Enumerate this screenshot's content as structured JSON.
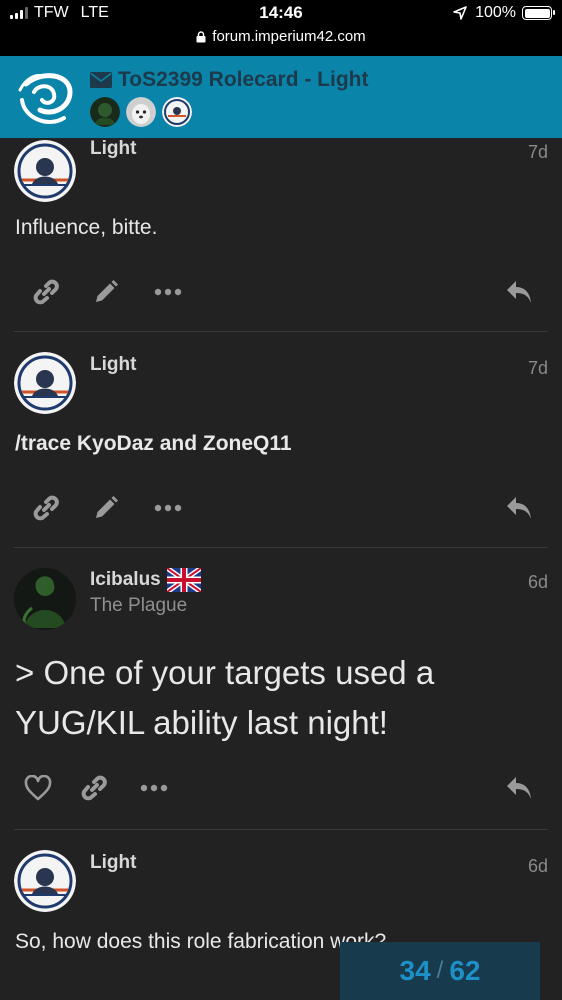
{
  "status_bar": {
    "carrier": "TFW",
    "network": "LTE",
    "time": "14:46",
    "battery": "100%",
    "battery_level": 1.0,
    "url": "forum.imperium42.com"
  },
  "header": {
    "topic_title": "ToS2399 Rolecard - Light",
    "icon": "envelope-icon"
  },
  "posts": [
    {
      "username": "Light",
      "date": "7d",
      "body": "Influence, bitte.",
      "actions": [
        "link-icon",
        "pencil-icon",
        "more-icon",
        "reply-icon"
      ]
    },
    {
      "username": "Light",
      "date": "7d",
      "body": "/trace KyoDaz and ZoneQ11",
      "actions": [
        "link-icon",
        "pencil-icon",
        "more-icon",
        "reply-icon"
      ]
    },
    {
      "username": "Icibalus",
      "user_title": "The Plague",
      "flag": "uk-flag-icon",
      "date": "6d",
      "body": "> One of your targets used a YUG/KIL ability last night!",
      "actions": [
        "heart-icon",
        "link-icon",
        "more-icon",
        "reply-icon"
      ]
    },
    {
      "username": "Light",
      "date": "6d",
      "body": "So, how does this role fabrication work?"
    }
  ],
  "progress": {
    "current": "34",
    "total": "62"
  },
  "colors": {
    "header_bg": "#0a84a8",
    "page_bg": "#222222",
    "progress_bg": "#173a4d",
    "progress_text": "#1e90c8"
  }
}
